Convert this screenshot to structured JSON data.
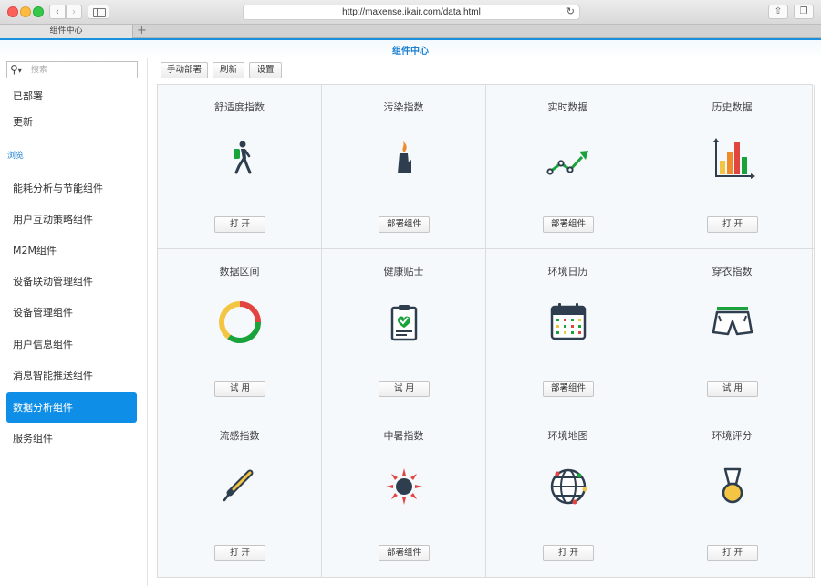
{
  "browser": {
    "url": "http://maxense.ikair.com/data.html",
    "tab_title": "组件中心",
    "new_tab": "+"
  },
  "app": {
    "title": "组件中心"
  },
  "search": {
    "placeholder": "搜索"
  },
  "sidebar": {
    "top_items": [
      {
        "label": "已部署"
      },
      {
        "label": "更新"
      }
    ],
    "section_label": "浏览",
    "items": [
      {
        "label": "能耗分析与节能组件",
        "active": false
      },
      {
        "label": "用户互动策略组件",
        "active": false
      },
      {
        "label": "M2M组件",
        "active": false
      },
      {
        "label": "设备联动管理组件",
        "active": false
      },
      {
        "label": "设备管理组件",
        "active": false
      },
      {
        "label": "用户信息组件",
        "active": false
      },
      {
        "label": "消息智能推送组件",
        "active": false
      },
      {
        "label": "数据分析组件",
        "active": true
      },
      {
        "label": "服务组件",
        "active": false
      }
    ]
  },
  "toolbar": {
    "manual_deploy": "手动部署",
    "refresh": "刷新",
    "settings": "设置"
  },
  "cards": [
    {
      "title": "舒适度指数",
      "icon": "hiker-icon",
      "button": "打 开"
    },
    {
      "title": "污染指数",
      "icon": "factory-icon",
      "button": "部署组件"
    },
    {
      "title": "实时数据",
      "icon": "trend-line-icon",
      "button": "部署组件"
    },
    {
      "title": "历史数据",
      "icon": "bar-chart-icon",
      "button": "打 开"
    },
    {
      "title": "数据区间",
      "icon": "donut-chart-icon",
      "button": "试 用"
    },
    {
      "title": "健康贴士",
      "icon": "clipboard-check-icon",
      "button": "试 用"
    },
    {
      "title": "环境日历",
      "icon": "calendar-icon",
      "button": "部署组件"
    },
    {
      "title": "穿衣指数",
      "icon": "shorts-icon",
      "button": "试 用"
    },
    {
      "title": "流感指数",
      "icon": "thermometer-icon",
      "button": "打 开"
    },
    {
      "title": "中暑指数",
      "icon": "sun-icon",
      "button": "部署组件"
    },
    {
      "title": "环境地图",
      "icon": "globe-icon",
      "button": "打 开"
    },
    {
      "title": "环境评分",
      "icon": "medal-icon",
      "button": "打 开"
    }
  ],
  "colors": {
    "accent": "#0f8ee8",
    "green": "#1aa23b",
    "red": "#e2443f",
    "yellow": "#f4c542",
    "dark": "#2f3e4e"
  }
}
